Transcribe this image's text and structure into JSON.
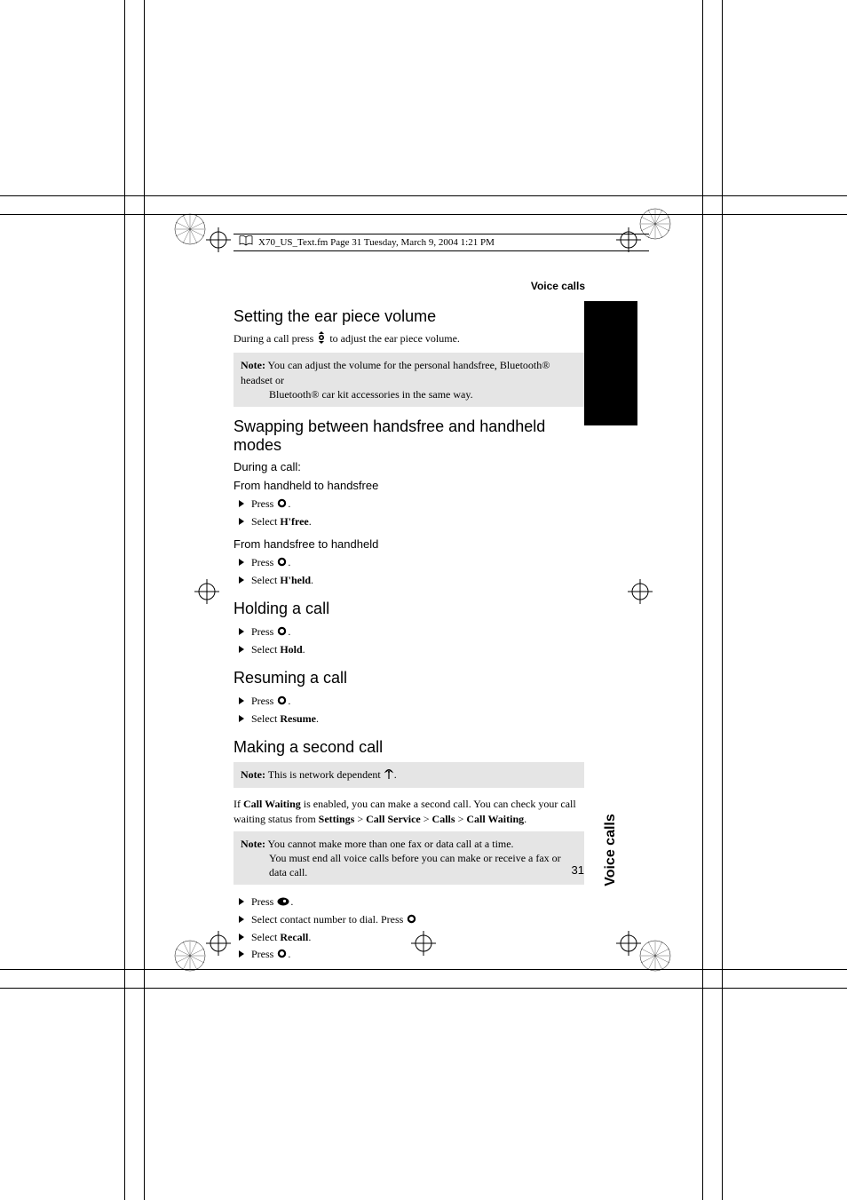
{
  "header": {
    "running": "X70_US_Text.fm  Page 31  Tuesday, March 9, 2004  1:21 PM",
    "section_header": "Voice calls"
  },
  "sections": {
    "earpiece": {
      "title": "Setting the ear piece volume",
      "body_pre": "During a call press ",
      "body_post": " to adjust the ear piece volume.",
      "note_label": "Note:",
      "note_l1": " You can adjust the volume for the personal handsfree, Bluetooth® headset or",
      "note_l2": "Bluetooth® car kit accessories in the same way."
    },
    "swap": {
      "title": "Swapping between handsfree and handheld modes",
      "during": "During a call:",
      "from_hh": "From handheld to handsfree",
      "from_hf": "From handsfree to handheld",
      "press": "Press ",
      "select": "Select ",
      "hfree": "H'free",
      "hheld": "H'held"
    },
    "hold": {
      "title": "Holding a call",
      "hold": "Hold"
    },
    "resume": {
      "title": "Resuming a call",
      "resume": "Resume"
    },
    "second": {
      "title": "Making a second call",
      "note1_label": "Note:",
      "note1_text": " This is network dependent ",
      "para_pre": "If ",
      "para_cw": "Call Waiting",
      "para_mid": " is enabled, you can make a second call. You can check your call waiting status from ",
      "crumb1": "Settings",
      "crumb2": "Call Service",
      "crumb3": "Calls",
      "crumb4": "Call Waiting",
      "note2_label": "Note:",
      "note2_l1": " You cannot make more than one fax or data call at a time.",
      "note2_l2": "You must end all voice calls before you can make or receive a fax or data call.",
      "step_contact": "Select contact number to dial. Press ",
      "recall": "Recall"
    }
  },
  "side_tab": "Voice calls",
  "page_number": "31"
}
